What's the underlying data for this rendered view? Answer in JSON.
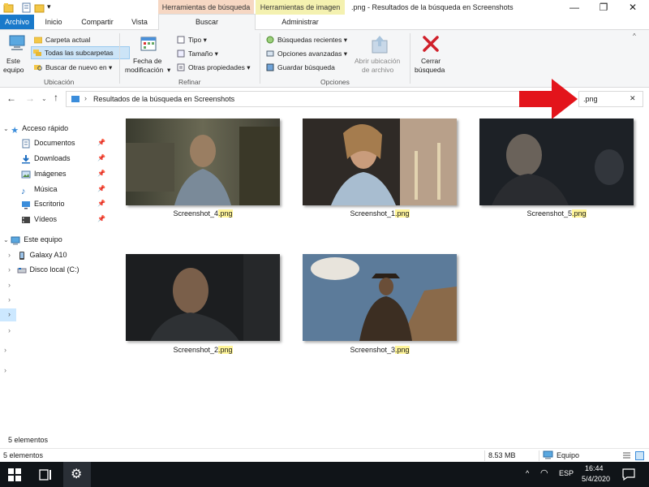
{
  "window": {
    "title": ".png - Resultados de la búsqueda en Screenshots",
    "context_search": "Herramientas de búsqueda",
    "context_image": "Herramientas de imagen",
    "minimize": "—",
    "maximize": "❐",
    "close": "✕"
  },
  "tabs": [
    "Archivo",
    "Inicio",
    "Compartir",
    "Vista",
    "Buscar",
    "Administrar"
  ],
  "ribbon": {
    "este_equipo": [
      "Este",
      "equipo"
    ],
    "carpeta_actual": "Carpeta actual",
    "todas_subcarpetas": "Todas las subcarpetas",
    "buscar_nuevo": "Buscar de nuevo en",
    "ubicacion": "Ubicación",
    "fecha_mod": [
      "Fecha de",
      "modificación"
    ],
    "tipo": "Tipo",
    "tamano": "Tamaño",
    "otras_prop": "Otras propiedades",
    "refinar": "Refinar",
    "busquedas_recientes": "Búsquedas recientes",
    "opciones_avanzadas": "Opciones avanzadas",
    "guardar_busqueda": "Guardar búsqueda",
    "abrir_ubicacion": [
      "Abrir ubicación",
      "de archivo"
    ],
    "opciones": "Opciones",
    "cerrar_busqueda": [
      "Cerrar",
      "búsqueda"
    ]
  },
  "address": {
    "path": "Resultados de la búsqueda en Screenshots",
    "search_value": ".png",
    "search_clear": "✕"
  },
  "nav": {
    "quick_access": "Acceso rápido",
    "quick_items": [
      "Documentos",
      "Downloads",
      "Imágenes",
      "Música",
      "Escritorio",
      "Vídeos"
    ],
    "this_pc": "Este equipo",
    "pc_items": [
      "Galaxy A10",
      "Disco local (C:)"
    ]
  },
  "files": [
    {
      "base": "Screenshot_4",
      "ext": ".png"
    },
    {
      "base": "Screenshot_1",
      "ext": ".png"
    },
    {
      "base": "Screenshot_5",
      "ext": ".png"
    },
    {
      "base": "Screenshot_2",
      "ext": ".png"
    },
    {
      "base": "Screenshot_3",
      "ext": ".png"
    }
  ],
  "footer_count": "5 elementos",
  "status": {
    "count": "5 elementos",
    "size": "8.53 MB",
    "location": "Equipo"
  },
  "taskbar": {
    "language": "ESP",
    "time": "16:44",
    "date": "5/4/2020"
  },
  "colors": {
    "accent": "#1979ca",
    "highlight": "#fff59a",
    "context_search": "#f6d7c3",
    "context_image": "#f4f1b0",
    "annotation_arrow": "#e3141b"
  }
}
